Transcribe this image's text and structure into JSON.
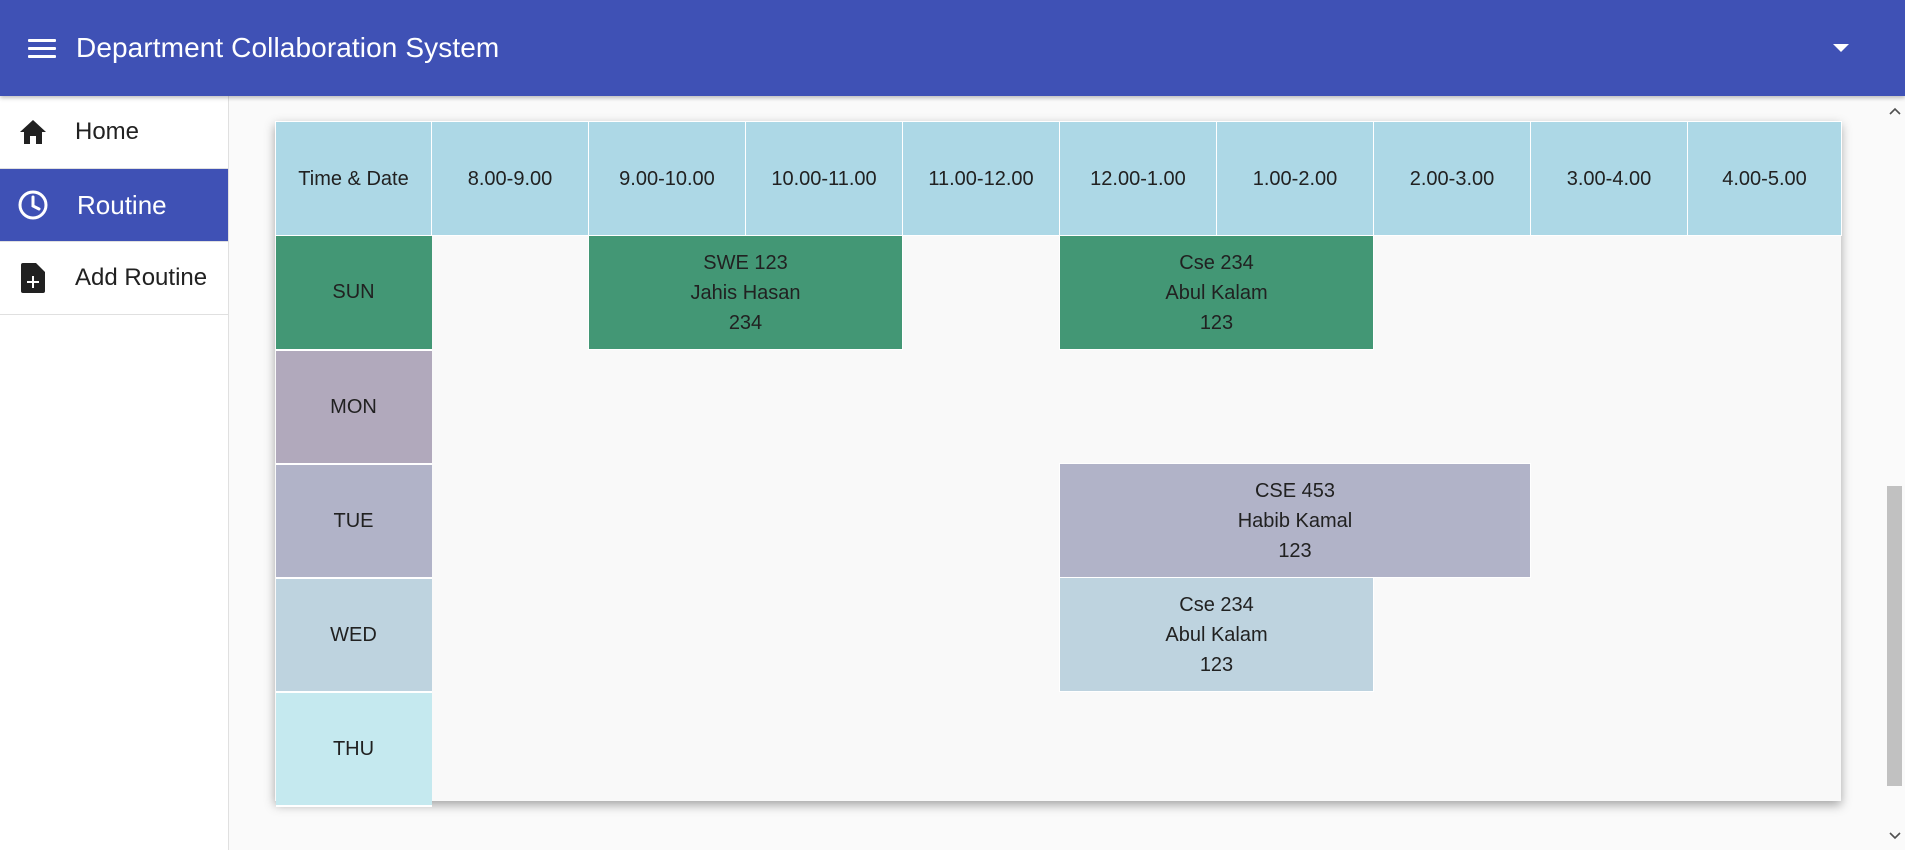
{
  "app": {
    "title": "Department Collaboration System"
  },
  "sidebar": {
    "items": [
      {
        "label": "Home",
        "icon": "home-icon"
      },
      {
        "label": "Routine",
        "icon": "clock-icon",
        "active": true
      },
      {
        "label": "Add Routine",
        "icon": "note-add-icon"
      }
    ]
  },
  "routine": {
    "header": {
      "corner": "Time & Date",
      "slots": [
        "8.00-9.00",
        "9.00-10.00",
        "10.00-11.00",
        "11.00-12.00",
        "12.00-1.00",
        "1.00-2.00",
        "2.00-3.00",
        "3.00-4.00",
        "4.00-5.00"
      ]
    },
    "days": {
      "sun": "SUN",
      "mon": "MON",
      "tue": "TUE",
      "wed": "WED",
      "thu": "THU"
    },
    "classes": {
      "sun_1": {
        "course": "SWE 123",
        "teacher": "Jahis Hasan",
        "room": "234"
      },
      "sun_2": {
        "course": "Cse 234",
        "teacher": "Abul Kalam",
        "room": "123"
      },
      "tue_1": {
        "course": "CSE 453",
        "teacher": "Habib Kamal",
        "room": "123"
      },
      "wed_1": {
        "course": "Cse 234",
        "teacher": "Abul Kalam",
        "room": "123"
      }
    }
  },
  "colors": {
    "appbar": "#3f51b5",
    "header": "#add8e6",
    "sun": "#439775",
    "mon": "#b1a9bc",
    "tue": "#b1b3c8",
    "wed": "#bed3df",
    "thu": "#c5e9ef"
  }
}
